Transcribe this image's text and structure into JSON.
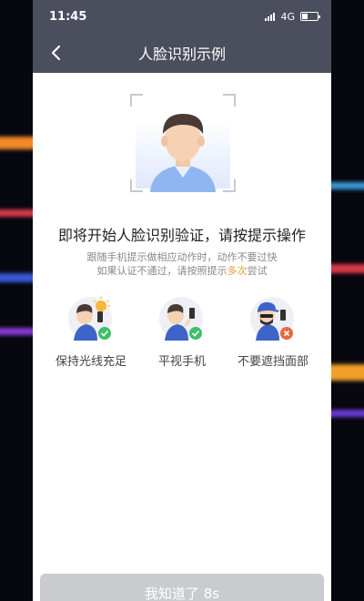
{
  "status_bar": {
    "time": "11:45",
    "network": "4G"
  },
  "nav": {
    "title": "人脸识别示例",
    "back_icon": "chevron-left-icon"
  },
  "instructions": {
    "headline": "即将开始人脸识别验证，请按提示操作",
    "line1": "跟随手机提示做相应动作时，动作不要过快",
    "line2_prefix": "如果认证不通过，请按照提示",
    "line2_highlight": "多次",
    "line2_suffix": "尝试"
  },
  "tips": [
    {
      "label": "保持光线充足",
      "status_icon": "check-icon",
      "illustration": "sun-light-icon"
    },
    {
      "label": "平视手机",
      "status_icon": "check-icon",
      "illustration": "selfie-eye-level-icon"
    },
    {
      "label": "不要遮挡面部",
      "status_icon": "close-icon",
      "illustration": "covered-face-icon"
    }
  ],
  "confirm_button": {
    "label": "我知道了 8s"
  },
  "colors": {
    "header_bg": "#4a4e5d",
    "accent": "#e39a3c",
    "ok_green": "#3fbf6a",
    "error_orange": "#e8683e",
    "button_disabled": "#c9cbcf"
  }
}
